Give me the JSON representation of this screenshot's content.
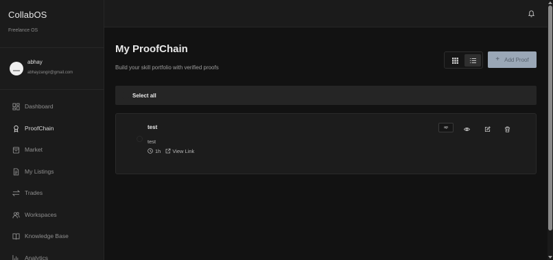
{
  "sidebar": {
    "brand": "CollabOS",
    "brand_subtitle": "Freelance OS",
    "user": {
      "name": "abhay",
      "email": "abhayzangir@gmail.com"
    },
    "items": [
      {
        "label": "Dashboard",
        "icon": "dashboard-icon",
        "active": false
      },
      {
        "label": "ProofChain",
        "icon": "award-icon",
        "active": true
      },
      {
        "label": "Market",
        "icon": "shopping-bag-icon",
        "active": false
      },
      {
        "label": "My Listings",
        "icon": "document-icon",
        "active": false
      },
      {
        "label": "Trades",
        "icon": "swap-arrows-icon",
        "active": false
      },
      {
        "label": "Workspaces",
        "icon": "users-icon",
        "active": false
      },
      {
        "label": "Knowledge Base",
        "icon": "book-open-icon",
        "active": false
      },
      {
        "label": "Analytics",
        "icon": "bar-chart-icon",
        "active": false
      }
    ]
  },
  "topbar": {
    "notification_icon": "bell-icon"
  },
  "main": {
    "title": "My ProofChain",
    "subtitle": "Build your skill portfolio with verified proofs",
    "add_button_label": "Add Proof",
    "select_all_label": "Select all",
    "proofs": [
      {
        "title": "test",
        "description": "test",
        "time": "1h",
        "link_label": "View Link",
        "tag": "ap"
      }
    ]
  },
  "colors": {
    "background": "#121212",
    "sidebar": "#1b1b1b",
    "card": "#1c1c1c",
    "select_bar": "#252525",
    "accent_button": "#9aa7b6"
  }
}
